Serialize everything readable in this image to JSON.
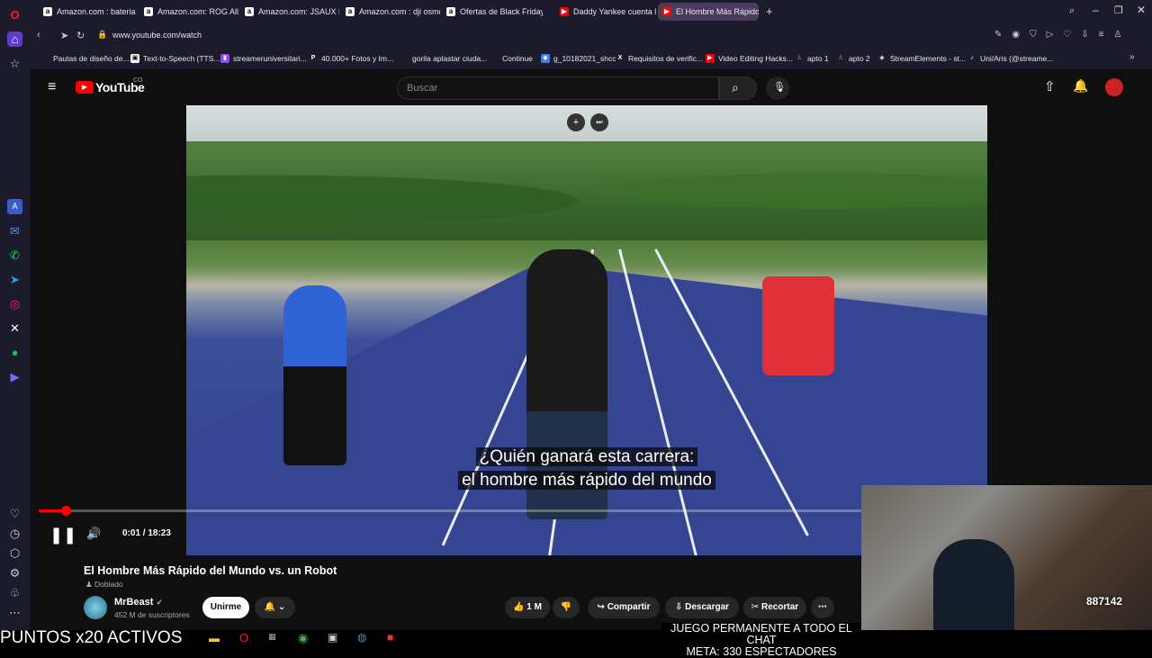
{
  "browser": {
    "tabs": [
      {
        "label": "Amazon.com : bateria rog",
        "favicon": "a"
      },
      {
        "label": "Amazon.com: ROG Ally Ba",
        "favicon": "a"
      },
      {
        "label": "Amazon.com: JSAUX Mod",
        "favicon": "a"
      },
      {
        "label": "Amazon.com : dji osmo",
        "favicon": "a"
      },
      {
        "label": "Ofertas de Black Friday 20",
        "favicon": "a"
      },
      {
        "label": "Daddy Yankee cuenta lo q",
        "favicon": "youtube"
      },
      {
        "label": "El Hombre Más Rápido",
        "favicon": "youtube"
      }
    ],
    "url": "www.youtube.com/watch",
    "bookmarks": [
      {
        "label": "Pautas de diseño de...",
        "color": "#ffffff"
      },
      {
        "label": "Text-to-Speech (TTS...",
        "color": "#ffffff"
      },
      {
        "label": "streameruniversitari...",
        "color": "#9146ff"
      },
      {
        "label": "40.000+ Fotos y Im...",
        "color": "#ffffff"
      },
      {
        "label": "gorila aplastar ciuda...",
        "color": "#ffffff"
      },
      {
        "label": "Continue",
        "color": "#ffffff"
      },
      {
        "label": "g_10182021_shcc",
        "color": "#3d7ef0"
      },
      {
        "label": "Requisitos de verific...",
        "color": "#ffffff"
      },
      {
        "label": "Video Editing Hacks...",
        "color": "#ff0000"
      },
      {
        "label": "apto 1",
        "color": "#ff5a5f"
      },
      {
        "label": "apto 2",
        "color": "#ff5a5f"
      },
      {
        "label": "StreamElements - st...",
        "color": "#ffffff"
      },
      {
        "label": "Uni/Aris (@streame...",
        "color": "#ffffff"
      }
    ]
  },
  "youtube": {
    "logo": "YouTube",
    "country": "CO",
    "search_placeholder": "Buscar",
    "video": {
      "subtitle_line1": "¿Quién ganará esta carrera:",
      "subtitle_line2": "el hombre más rápido del mundo",
      "time": "0:01 / 18:23",
      "progress": 0.001
    },
    "title": "El Hombre Más Rápido del Mundo vs. un Robot",
    "dubbed": "Doblado",
    "channel": "MrBeast",
    "subscribers": "452 M de suscriptores",
    "join": "Unirme",
    "likes": "1 M",
    "share": "Compartir",
    "download": "Descargar",
    "clip": "Recortar"
  },
  "stream_overlay": {
    "points": "PUNTOS x20 ACTIVOS",
    "chat_line1": "JUEGO PERMANENTE A TODO EL CHAT",
    "chat_line2": "META: 330 ESPECTADORES",
    "counter": "887142"
  },
  "colors": {
    "accent": "#ff0000",
    "browser_bg": "#1c1b2b",
    "yt_bg": "#0f0f0f"
  }
}
